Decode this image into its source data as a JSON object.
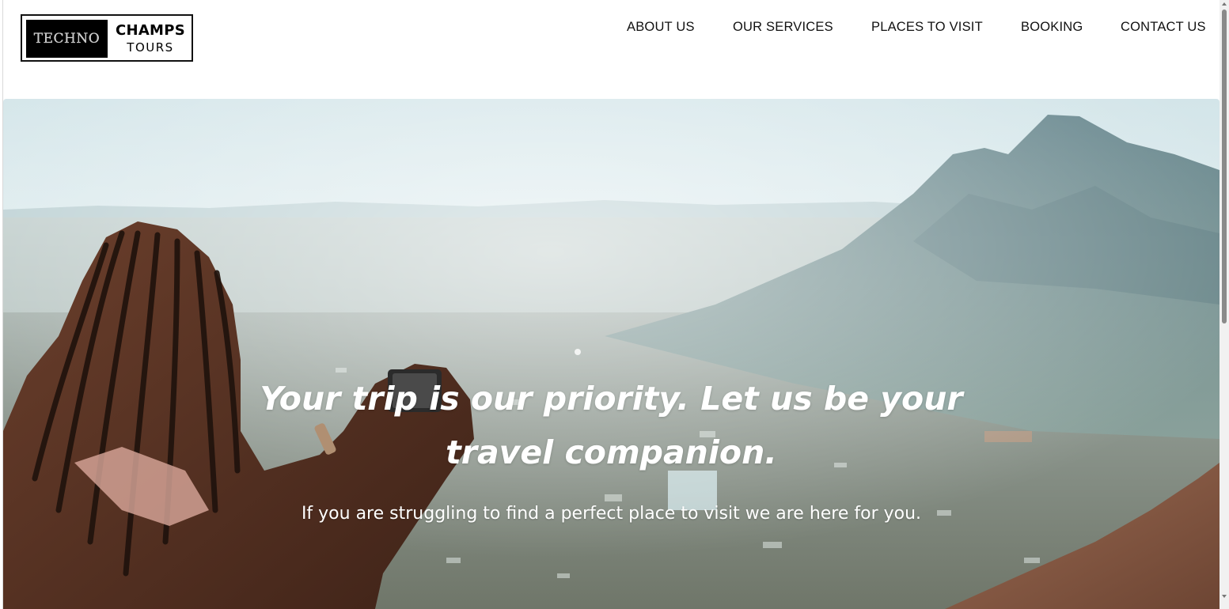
{
  "header": {
    "logo": {
      "left_text": "TECHNO",
      "right_top": "CHAMPS",
      "right_bottom": "TOURS"
    },
    "nav": [
      {
        "label": "ABOUT US"
      },
      {
        "label": "OUR SERVICES"
      },
      {
        "label": "PLACES TO VISIT"
      },
      {
        "label": "BOOKING"
      },
      {
        "label": "CONTACT US"
      }
    ]
  },
  "hero": {
    "title_line_1": "Your trip is our priority. Let us be your",
    "title_line_2": "travel companion.",
    "subtitle": "If you are struggling to find a perfect place to visit we are here for you.",
    "image": "woman photographing a mountain city view with a phone"
  },
  "colors": {
    "nav_text": "#111111",
    "logo_box": "#000000",
    "hero_text": "#ffffff",
    "sky": "#d6e6ea",
    "mountain": "#6f8d93",
    "scrollbar_thumb": "#8a8a8a"
  }
}
